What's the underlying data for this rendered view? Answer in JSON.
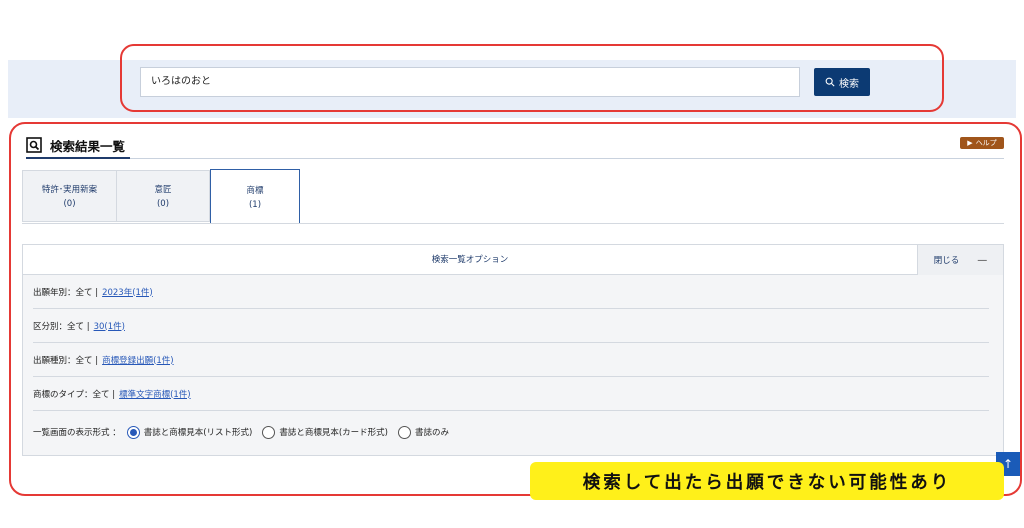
{
  "search": {
    "value": "いろはのおと",
    "button_label": "検索"
  },
  "results": {
    "title": "検索結果一覧",
    "help_label": "ヘルプ"
  },
  "tabs": [
    {
      "label": "特許･実用新案",
      "count": "(0)"
    },
    {
      "label": "意匠",
      "count": "(0)"
    },
    {
      "label": "商標",
      "count": "(1)"
    }
  ],
  "options": {
    "title": "検索一覧オプション",
    "close_label": "閉じる",
    "close_symbol": "—",
    "filters": [
      {
        "label": "出願年別：全て |",
        "link": "2023年(1件)"
      },
      {
        "label": "区分別：全て |",
        "link": "30(1件)"
      },
      {
        "label": "出願種別：全て |",
        "link": "商標登録出願(1件)"
      },
      {
        "label": "商標のタイプ：全て |",
        "link": "標準文字商標(1件)"
      }
    ],
    "display_label": "一覧画面の表示形式 ：",
    "display_options": [
      {
        "label": "書誌と商標見本(リスト形式)",
        "checked": true
      },
      {
        "label": "書誌と商標見本(カード形式)",
        "checked": false
      },
      {
        "label": "書誌のみ",
        "checked": false
      }
    ]
  },
  "scroll_top_symbol": "↑",
  "annotation_note": "検索して出たら出願できない可能性あり",
  "colors": {
    "primary": "#0c3a73",
    "link": "#2758b8",
    "annotation_red": "#e53935",
    "note_yellow": "#fff01a",
    "help_brown": "#a0551b"
  }
}
